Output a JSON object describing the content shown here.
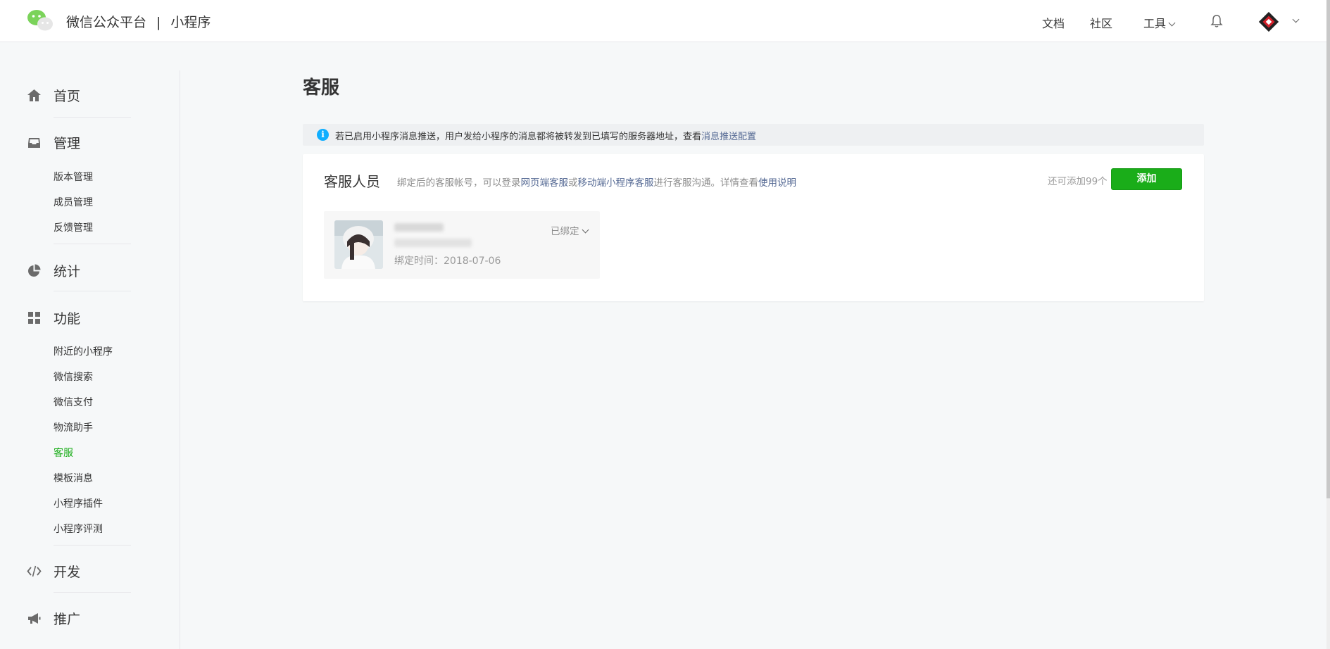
{
  "header": {
    "brand": "微信公众平台",
    "separator": "|",
    "product": "小程序",
    "nav": [
      {
        "label": "文档"
      },
      {
        "label": "社区"
      }
    ],
    "tools_label": "工具",
    "icons": {
      "logo": "wechat-logo",
      "bell": "bell-icon",
      "account": "account-avatar"
    }
  },
  "sidebar": {
    "groups": [
      {
        "label": "首页",
        "icon": "home-icon",
        "items": []
      },
      {
        "label": "管理",
        "icon": "inbox-icon",
        "items": [
          "版本管理",
          "成员管理",
          "反馈管理"
        ]
      },
      {
        "label": "统计",
        "icon": "pie-chart-icon",
        "items": []
      },
      {
        "label": "功能",
        "icon": "grid-icon",
        "items": [
          "附近的小程序",
          "微信搜索",
          "微信支付",
          "物流助手",
          "客服",
          "模板消息",
          "小程序插件",
          "小程序评测"
        ]
      },
      {
        "label": "开发",
        "icon": "code-icon",
        "items": []
      },
      {
        "label": "推广",
        "icon": "megaphone-icon",
        "items": []
      }
    ],
    "active_item": "客服"
  },
  "main": {
    "title": "客服",
    "notice": {
      "text": "若已启用小程序消息推送，用户发给小程序的消息都将被转发到已填写的服务器地址，查看",
      "link": "消息推送配置"
    },
    "card": {
      "title": "客服人员",
      "desc_1": "绑定后的客服帐号，可以登录",
      "link_1": "网页端客服",
      "desc_2": "或",
      "link_2": "移动端小程序客服",
      "desc_3": "进行客服沟通。详情查看",
      "link_3": "使用说明",
      "remaining": "还可添加99个",
      "add_label": "添加",
      "member": {
        "bind_time": "绑定时间：2018-07-06",
        "status": "已绑定"
      }
    }
  },
  "colors": {
    "accent": "#1aad19",
    "link": "#576b95",
    "info": "#10aeff"
  }
}
